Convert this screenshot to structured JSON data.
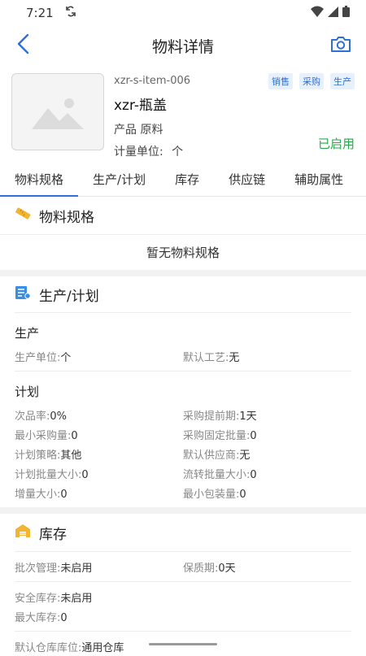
{
  "status_bar": {
    "time": "7:21"
  },
  "nav": {
    "title": "物料详情"
  },
  "item": {
    "code": "xzr-s-item-006",
    "name": "xzr-瓶盖",
    "type_label": "产品",
    "type_value": "原料",
    "unit_label": "计量单位:",
    "unit_value": "个",
    "status": "已启用",
    "tags": [
      "销售",
      "采购",
      "生产"
    ]
  },
  "tabs": [
    "物料规格",
    "生产/计划",
    "库存",
    "供应链",
    "辅助属性"
  ],
  "spec_section": {
    "title": "物料规格",
    "empty": "暂无物料规格"
  },
  "production_section": {
    "title": "生产/计划",
    "production": {
      "title": "生产",
      "unit_label": "生产单位:",
      "unit_value": "个",
      "routing_label": "默认工艺:",
      "routing_value": "无"
    },
    "plan": {
      "title": "计划",
      "rows": [
        [
          {
            "k": "次品率:",
            "v": "0%"
          },
          {
            "k": "采购提前期:",
            "v": "1天"
          }
        ],
        [
          {
            "k": "最小采购量:",
            "v": "0"
          },
          {
            "k": "采购固定批量:",
            "v": "0"
          }
        ],
        [
          {
            "k": "计划策略:",
            "v": "其他"
          },
          {
            "k": "默认供应商:",
            "v": "无"
          }
        ],
        [
          {
            "k": "计划批量大小:",
            "v": "0"
          },
          {
            "k": "流转批量大小:",
            "v": "0"
          }
        ],
        [
          {
            "k": "增量大小:",
            "v": "0"
          },
          {
            "k": "最小包装量:",
            "v": "0"
          }
        ]
      ]
    }
  },
  "inventory_section": {
    "title": "库存",
    "batch_label": "批次管理:",
    "batch_value": "未启用",
    "shelf_label": "保质期:",
    "shelf_value": "0天",
    "safety_label": "安全库存:",
    "safety_value": "未启用",
    "max_label": "最大库存:",
    "max_value": "0",
    "location_label": "默认仓库库位:",
    "location_value": "通用仓库"
  }
}
